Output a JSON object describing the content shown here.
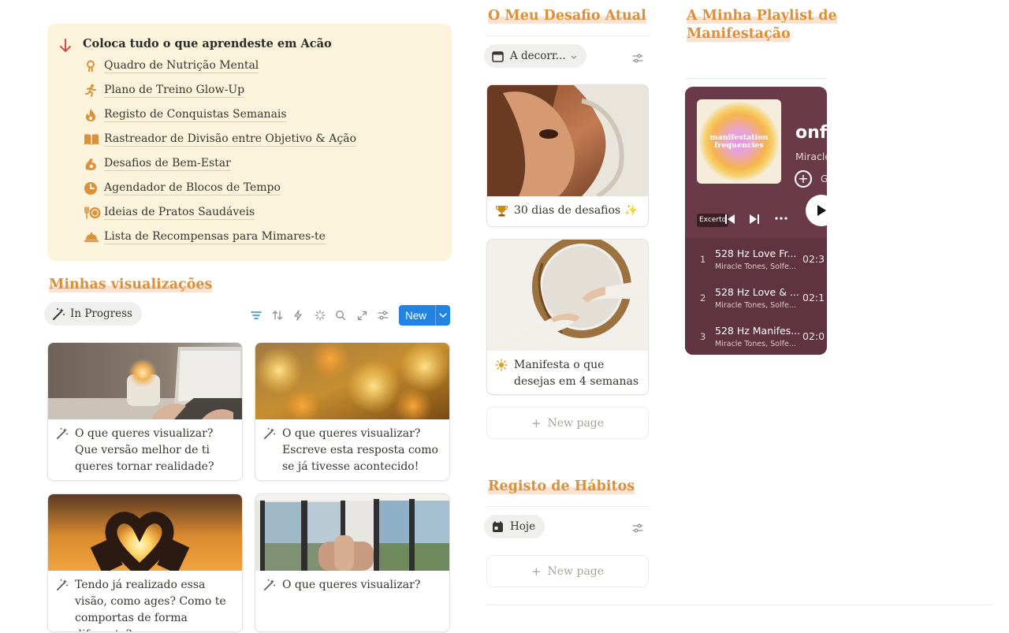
{
  "callout": {
    "title": "Coloca tudo o que aprendeste em Acão",
    "items": [
      {
        "label": "Quadro de Nutrição Mental",
        "icon": "brain-icon"
      },
      {
        "label": "Plano de Treino Glow-Up",
        "icon": "running-icon"
      },
      {
        "label": "Registo de Conquistas Semanais",
        "icon": "fire-icon"
      },
      {
        "label": "Rastreador de Divisão entre Objetivo & Ação",
        "icon": "book-icon"
      },
      {
        "label": "Desafios de Bem-Estar",
        "icon": "flexed-arm-icon"
      },
      {
        "label": "Agendador de Blocos de Tempo",
        "icon": "clock-icon"
      },
      {
        "label": "Ideias de Pratos Saudáveis",
        "icon": "fork-plate-icon"
      },
      {
        "label": "Lista de Recompensas para Mimares-te",
        "icon": "cloche-icon"
      }
    ],
    "colors": {
      "background": "#fbf3db",
      "icon": "#d9913a",
      "arrow": "#d44c47"
    }
  },
  "visualizations": {
    "heading": "Minhas visualizações",
    "view_label": "In Progress",
    "new_button": "New",
    "cards": [
      {
        "caption": "O que queres visualizar? Que versão melhor de ti queres tornar realidade?"
      },
      {
        "caption": "O que queres visualizar? Escreve esta resposta como se já tivesse acontecido!"
      },
      {
        "caption": "Tendo já realizado essa visão, como ages? Como te comportas de forma diferente?"
      },
      {
        "caption": "O que queres visualizar?"
      }
    ]
  },
  "challenge": {
    "heading": "O Meu Desafio Atual",
    "view_label": "A decorr...",
    "cards": [
      {
        "title": "30 dias de desafios ✨",
        "icon": "trophy-icon"
      },
      {
        "title": "Manifesta o que desejas em 4 semanas",
        "icon": "sun-icon"
      }
    ],
    "new_page": "New page"
  },
  "habits": {
    "heading": "Registo de Hábitos",
    "view_label": "Hoje",
    "new_page": "New page"
  },
  "playlist": {
    "heading_line1": "A Minha Playlist de",
    "heading_line2": "Manifestação",
    "cover_line1": "manifestation",
    "cover_line2": "frequencies",
    "title_fragment": "onfi",
    "artist_fragment": "Miracle",
    "g_fragment": "G",
    "badge": "Excerto",
    "tracks": [
      {
        "num": "1",
        "name": "528 Hz Love Fr...",
        "artist": "Miracle Tones, Solfe...",
        "duration": "02:3"
      },
      {
        "num": "2",
        "name": "528 Hz Love & ...",
        "artist": "Miracle Tones, Solfe...",
        "duration": "02:1"
      },
      {
        "num": "3",
        "name": "528 Hz Manifes...",
        "artist": "Miracle Tones, Solfe...",
        "duration": "02:0"
      }
    ],
    "colors": {
      "background": "#6b3a48",
      "tracks_background": "#5f3340"
    }
  },
  "theme": {
    "heading_color": "#d9923c",
    "heading_highlight": "#fbe1cf",
    "accent_blue": "#2383e2"
  }
}
